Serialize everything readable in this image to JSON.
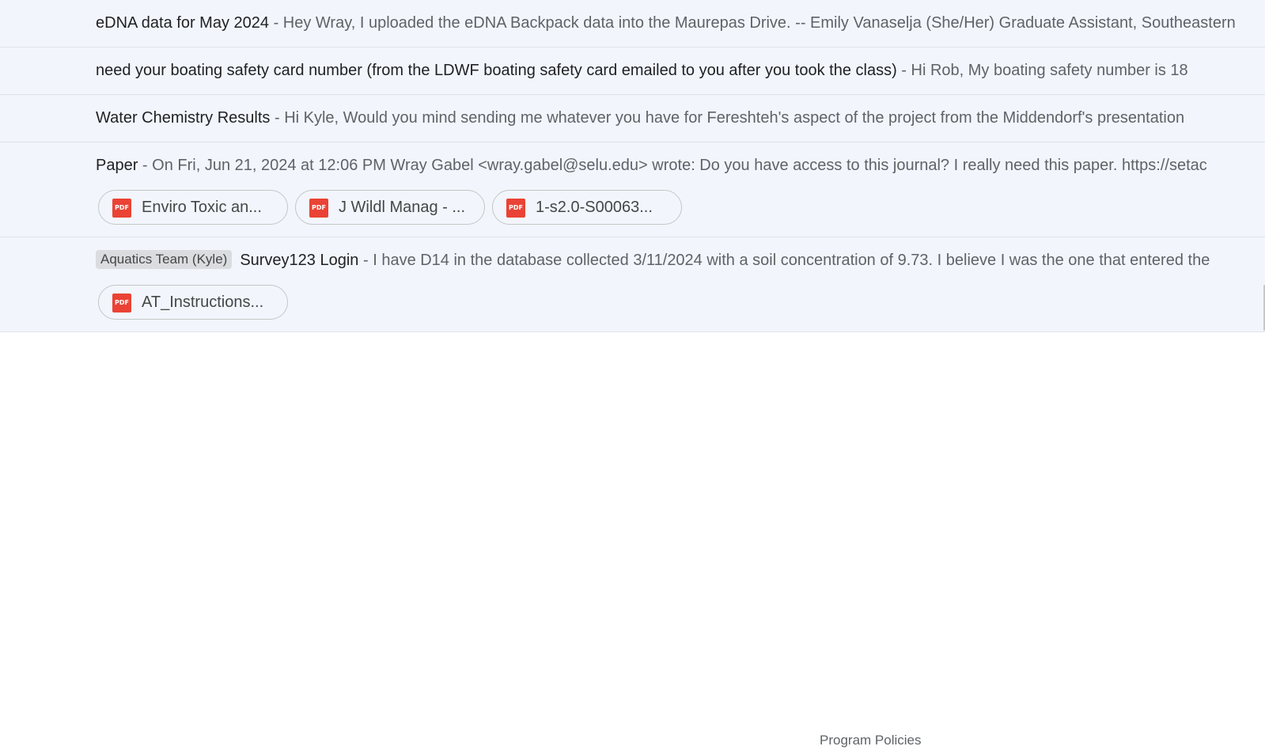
{
  "emails": [
    {
      "subject": "eDNA data for May 2024",
      "separator": " - ",
      "snippet": "Hey Wray, I uploaded the eDNA Backpack data into the Maurepas Drive. -- Emily Vanaselja (She/Her) Graduate Assistant, Southeastern"
    },
    {
      "subject": "need your boating safety card number (from the LDWF boating safety card emailed to you after you took the class)",
      "separator": " - ",
      "snippet": "Hi Rob, My boating safety number is 18"
    },
    {
      "subject": "Water Chemistry Results",
      "separator": " - ",
      "snippet": "Hi Kyle, Would you mind sending me whatever you have for Fereshteh's aspect of the project from the Middendorf's presentation"
    },
    {
      "subject": "Paper",
      "separator": " - ",
      "snippet": "On Fri, Jun 21, 2024 at 12:06 PM Wray Gabel <wray.gabel@selu.edu> wrote: Do you have access to this journal? I really need this paper. https://setac",
      "attachments": [
        {
          "icon": "pdf-icon",
          "icon_text": "PDF",
          "name": "Enviro Toxic an..."
        },
        {
          "icon": "pdf-icon",
          "icon_text": "PDF",
          "name": "J Wildl Manag - ..."
        },
        {
          "icon": "pdf-icon",
          "icon_text": "PDF",
          "name": "1-s2.0-S00063..."
        }
      ]
    },
    {
      "label": "Aquatics Team (Kyle)",
      "subject": "Survey123 Login",
      "separator": " - ",
      "snippet": "I have D14 in the database collected 3/11/2024 with a soil concentration of 9.73. I believe I was the one that entered the",
      "attachments": [
        {
          "icon": "pdf-icon",
          "icon_text": "PDF",
          "name": "AT_Instructions..."
        }
      ]
    }
  ],
  "footer": {
    "program_policies": "Program Policies"
  },
  "colors": {
    "row_background": "#f2f6fc",
    "pdf_red": "#ea4335",
    "label_gray": "#dadce0"
  }
}
